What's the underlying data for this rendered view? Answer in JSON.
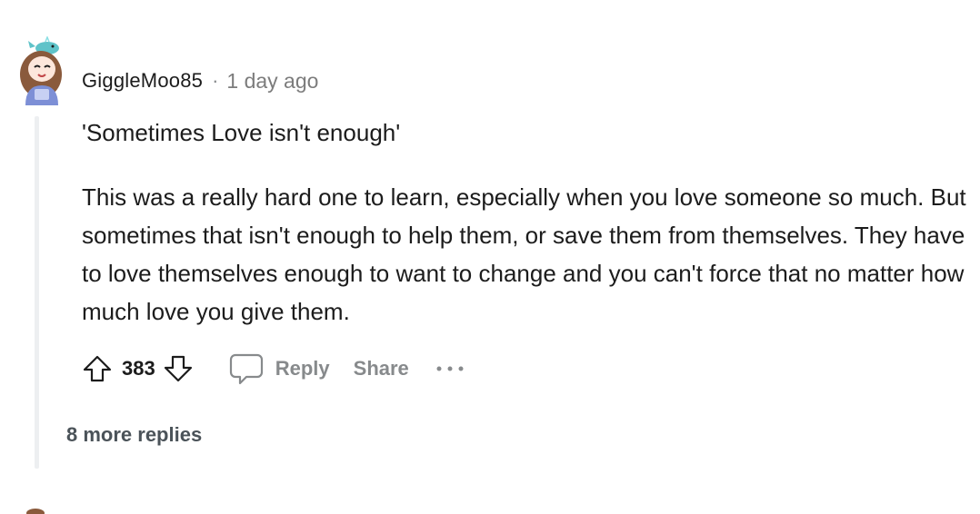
{
  "comment": {
    "author": "GiggleMoo85",
    "separator": "·",
    "timestamp": "1 day ago",
    "quote": "'Sometimes Love isn't enough'",
    "text": "This was a really hard one to learn, especially when you love someone so much. But sometimes that isn't enough to help them, or save them from themselves. They have to love themselves enough to want to change and you can't force that no matter how much love you give them."
  },
  "actions": {
    "score": "383",
    "reply_label": "Reply",
    "share_label": "Share"
  },
  "thread": {
    "more_replies": "8 more replies"
  },
  "icons": {
    "upvote": "upvote-arrow-icon",
    "downvote": "downvote-arrow-icon",
    "reply": "speech-bubble-icon",
    "more": "ellipsis-icon"
  },
  "colors": {
    "text": "#1c1c1c",
    "meta": "#878a8c",
    "thread_line": "#edeff1",
    "more_replies": "#4b5359"
  }
}
